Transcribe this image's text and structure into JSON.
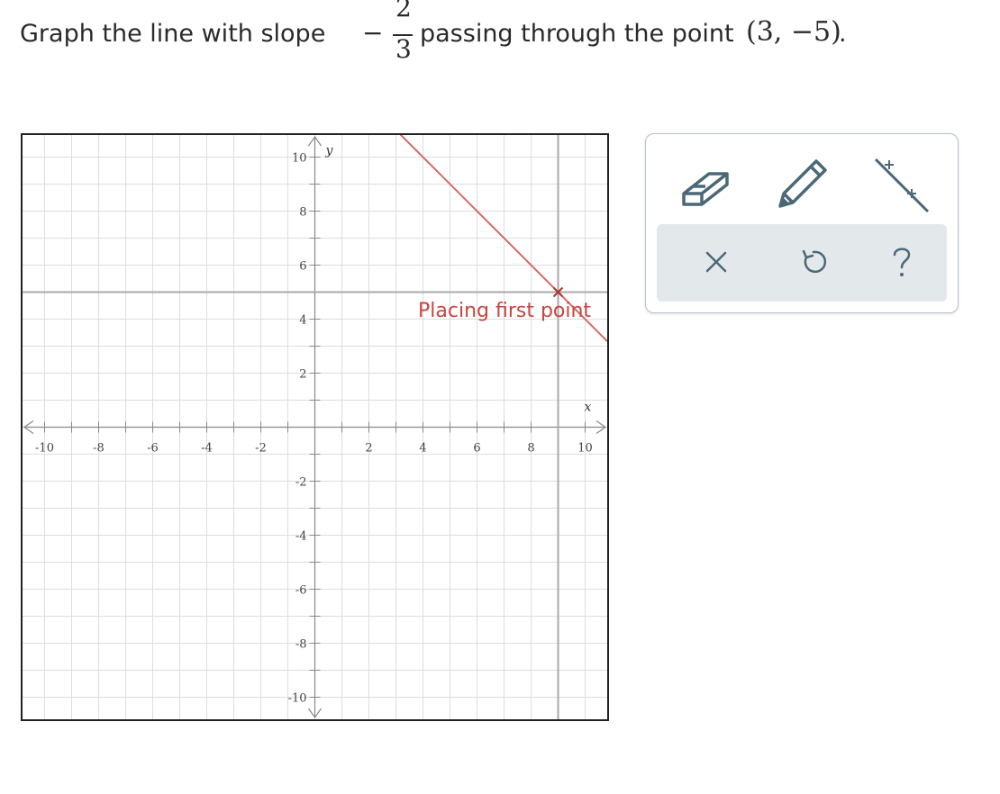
{
  "question": {
    "prefix": "Graph the line with slope",
    "slope_sign": "−",
    "slope_numerator": "2",
    "slope_denominator": "3",
    "middle": "passing through the point",
    "point": "(3, −5)",
    "suffix": "."
  },
  "graph": {
    "status_label": "Placing first point",
    "x_axis_label": "x",
    "y_axis_label": "y",
    "x_ticks": [
      "-10",
      "-8",
      "-6",
      "-4",
      "-2",
      "2",
      "4",
      "6",
      "8",
      "10"
    ],
    "y_ticks": [
      "10",
      "8",
      "6",
      "4",
      "2",
      "-2",
      "-4",
      "-6",
      "-8",
      "-10"
    ],
    "crosshair": {
      "x": 9,
      "y": 5
    },
    "drawn_line": {
      "through": [
        9,
        5
      ],
      "slope": -1
    },
    "colors": {
      "line": "#d46a66",
      "grid": "#dddddd",
      "crosshair": "#aaaaaa"
    }
  },
  "toolbox": {
    "tools": [
      {
        "name": "eraser",
        "icon": "eraser-icon"
      },
      {
        "name": "pencil",
        "icon": "pencil-icon"
      },
      {
        "name": "line",
        "icon": "line-tool-icon"
      }
    ],
    "actions": [
      {
        "name": "clear",
        "icon": "close-icon"
      },
      {
        "name": "undo",
        "icon": "undo-icon"
      },
      {
        "name": "help",
        "icon": "help-icon"
      }
    ]
  }
}
